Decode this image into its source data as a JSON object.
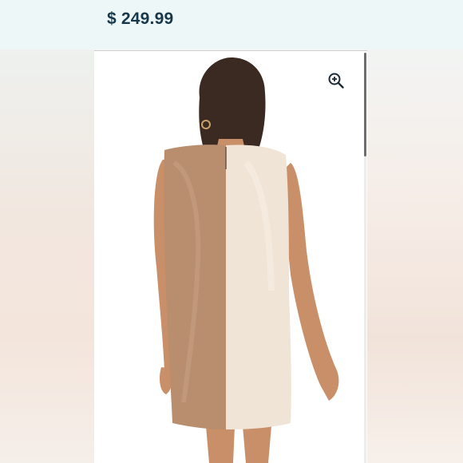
{
  "header": {
    "price": "$ 249.99"
  },
  "product_image": {
    "description_icon": "zoom-in-icon",
    "colors": {
      "left_panel": "#b88e6e",
      "right_panel": "#efe4d5",
      "hair": "#3a2a22",
      "skin": "#c98f68"
    }
  },
  "colors": {
    "price_text": "#17384a",
    "header_bg": "#eef7f8"
  }
}
